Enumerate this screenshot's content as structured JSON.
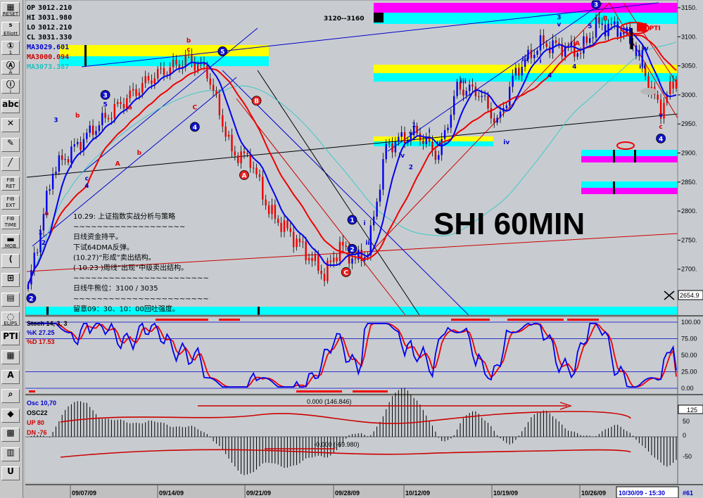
{
  "toolbar": [
    {
      "name": "reset-button",
      "glyph": "▦",
      "label": "RESET"
    },
    {
      "name": "elliott-button",
      "glyph": "⁵",
      "label": "Elliott"
    },
    {
      "name": "elliott-count-1-button",
      "glyph": "①",
      "label": "1"
    },
    {
      "name": "elliott-count-a-button",
      "glyph": "Ⓐ",
      "label": "A"
    },
    {
      "name": "elliott-count-i-button",
      "glyph": "ⓘ",
      "label": "i"
    },
    {
      "name": "elliott-count-abc-button",
      "glyph": "abc",
      "label": ""
    },
    {
      "name": "cross-tool-button",
      "glyph": "✕",
      "label": ""
    },
    {
      "name": "pencil-tool-button",
      "glyph": "✎",
      "label": ""
    },
    {
      "name": "line-tool-button",
      "glyph": "╱",
      "label": ""
    },
    {
      "name": "fib-ret-button",
      "glyph": "",
      "label": "FIB RET"
    },
    {
      "name": "fib-ext-button",
      "glyph": "",
      "label": "FIB EXT"
    },
    {
      "name": "fib-time-button",
      "glyph": "",
      "label": "FIB TIME"
    },
    {
      "name": "mob-button",
      "glyph": "▬",
      "label": "MOB"
    },
    {
      "name": "fan-button",
      "glyph": "⟨",
      "label": ""
    },
    {
      "name": "channel-button",
      "glyph": "⊞",
      "label": ""
    },
    {
      "name": "grid-button",
      "glyph": "▤",
      "label": ""
    },
    {
      "name": "ellipse-button",
      "glyph": "◌",
      "label": "ELIPS"
    },
    {
      "name": "pti-button",
      "glyph": "PTI",
      "label": ""
    },
    {
      "name": "box-button",
      "glyph": "▦",
      "label": ""
    },
    {
      "name": "text-tool-button",
      "glyph": "A",
      "label": ""
    },
    {
      "name": "zoom-button",
      "glyph": "⌕",
      "label": ""
    },
    {
      "name": "eraser-button",
      "glyph": "◆",
      "label": ""
    },
    {
      "name": "checker-button",
      "glyph": "▩",
      "label": ""
    },
    {
      "name": "notes-button",
      "glyph": "▥",
      "label": ""
    },
    {
      "name": "magnet-button",
      "glyph": "U",
      "label": ""
    }
  ],
  "ohlc": [
    {
      "key": "OP",
      "value": "3012.210"
    },
    {
      "key": "HI",
      "value": "3031.980"
    },
    {
      "key": "LO",
      "value": "3012.210"
    },
    {
      "key": "CL",
      "value": "3031.330"
    }
  ],
  "ma": [
    {
      "label": "MA3029.601",
      "color": "#0000cc"
    },
    {
      "label": "MA3000.094",
      "color": "#cc0000"
    },
    {
      "label": "MA3073.387",
      "color": "#20c0c0"
    }
  ],
  "chart_data": {
    "type": "candlestick",
    "title": "SHI 60MIN",
    "y_axis_ticks": [
      3150,
      3100,
      3050,
      3000,
      2950,
      2900,
      2850,
      2800,
      2750,
      2700
    ],
    "ylim": [
      2635,
      3160
    ],
    "current_price_box": "2654.9",
    "date_labels": [
      "09/07/09",
      "09/14/09",
      "09/21/09",
      "09/28/09",
      "10/12/09",
      "10/19/09",
      "10/26/09"
    ],
    "last_bar_label": "10/30/09 - 15:30",
    "bar_count_label": "#61",
    "price_anchors": [
      [
        0,
        2668
      ],
      [
        8,
        2870
      ],
      [
        18,
        2925
      ],
      [
        30,
        2985
      ],
      [
        40,
        3030
      ],
      [
        52,
        3062
      ],
      [
        58,
        3040
      ],
      [
        62,
        2970
      ],
      [
        66,
        2900
      ],
      [
        72,
        2890
      ],
      [
        78,
        2800
      ],
      [
        86,
        2755
      ],
      [
        96,
        2690
      ],
      [
        101,
        2740
      ],
      [
        106,
        2715
      ],
      [
        110,
        2730
      ],
      [
        116,
        2910
      ],
      [
        121,
        2925
      ],
      [
        126,
        2935
      ],
      [
        133,
        2895
      ],
      [
        139,
        3012
      ],
      [
        146,
        3005
      ],
      [
        152,
        2950
      ],
      [
        158,
        3040
      ],
      [
        166,
        3088
      ],
      [
        173,
        3082
      ],
      [
        179,
        3075
      ],
      [
        184,
        3120
      ],
      [
        191,
        3115
      ],
      [
        196,
        3090
      ],
      [
        202,
        3005
      ],
      [
        205,
        2975
      ],
      [
        210,
        3032
      ]
    ],
    "range_label": "3120--3160",
    "pti_label": "80 PTI",
    "commentary": [
      "10.29: 上证指数实战分析与策略",
      "~~~~~~~~~~~~~~~~~~~",
      "日线资金持平。",
      "下试64DMA反弹。",
      "(10.27)“形成”卖出结构。",
      "( 10.23 )周线“出现”中级卖出结构。",
      "~~~~~~~~~~~~~~~~~~~~~~~",
      "日线牛熊位：3100 / 3035",
      "~~~~~~~~~~~~~~~~~~~~~~~",
      "留意09：30、10：00回吐强度。"
    ],
    "wave_labels": [
      {
        "bar": 1,
        "price": 2650,
        "text": "2",
        "style": "blue-circle"
      },
      {
        "bar": 4,
        "price": 2760,
        "text": "1",
        "style": "blue"
      },
      {
        "bar": 5,
        "price": 2742,
        "text": "2",
        "style": "blue"
      },
      {
        "bar": 6,
        "price": 2793,
        "text": "a",
        "style": "red"
      },
      {
        "bar": 9,
        "price": 2953,
        "text": "3",
        "style": "blue"
      },
      {
        "bar": 16,
        "price": 2961,
        "text": "b",
        "style": "red"
      },
      {
        "bar": 19,
        "price": 2853,
        "text": "c",
        "style": "blue"
      },
      {
        "bar": 19,
        "price": 2840,
        "text": "4",
        "style": "blue"
      },
      {
        "bar": 25,
        "price": 3000,
        "text": "3",
        "style": "blue-circle"
      },
      {
        "bar": 25,
        "price": 2980,
        "text": "5",
        "style": "blue"
      },
      {
        "bar": 29,
        "price": 2878,
        "text": "A",
        "style": "red"
      },
      {
        "bar": 33,
        "price": 2975,
        "text": "a",
        "style": "red"
      },
      {
        "bar": 36,
        "price": 2897,
        "text": "b",
        "style": "red"
      },
      {
        "bar": 52,
        "price": 3090,
        "text": "b",
        "style": "red"
      },
      {
        "bar": 52,
        "price": 3075,
        "text": "c",
        "style": "red"
      },
      {
        "bar": 54,
        "price": 2975,
        "text": "C",
        "style": "red"
      },
      {
        "bar": 54,
        "price": 2945,
        "text": "4",
        "style": "blue-circle"
      },
      {
        "bar": 63,
        "price": 3075,
        "text": "5",
        "style": "blue-circle"
      },
      {
        "bar": 74,
        "price": 2990,
        "text": "B",
        "style": "red-circle"
      },
      {
        "bar": 70,
        "price": 2862,
        "text": "A",
        "style": "red-circle"
      },
      {
        "bar": 105,
        "price": 2785,
        "text": "1",
        "style": "blue-circle"
      },
      {
        "bar": 105,
        "price": 2735,
        "text": "2",
        "style": "blue-circle"
      },
      {
        "bar": 109,
        "price": 2776,
        "text": "i",
        "style": "blue"
      },
      {
        "bar": 110,
        "price": 2742,
        "text": "ii",
        "style": "blue"
      },
      {
        "bar": 103,
        "price": 2695,
        "text": "C",
        "style": "red-circle"
      },
      {
        "bar": 121,
        "price": 2892,
        "text": "iv",
        "style": "blue"
      },
      {
        "bar": 124,
        "price": 2872,
        "text": "2",
        "style": "blue"
      },
      {
        "bar": 125,
        "price": 2945,
        "text": "1",
        "style": "blue"
      },
      {
        "bar": 124,
        "price": 2930,
        "text": "v",
        "style": "blue"
      },
      {
        "bar": 130,
        "price": 2935,
        "text": "i",
        "style": "blue"
      },
      {
        "bar": 133,
        "price": 2913,
        "text": "ii",
        "style": "blue"
      },
      {
        "bar": 141,
        "price": 3020,
        "text": "iii",
        "style": "blue"
      },
      {
        "bar": 155,
        "price": 2915,
        "text": "iv",
        "style": "blue"
      },
      {
        "bar": 172,
        "price": 3130,
        "text": "3",
        "style": "blue"
      },
      {
        "bar": 172,
        "price": 3118,
        "text": "v",
        "style": "blue"
      },
      {
        "bar": 169,
        "price": 3030,
        "text": "4",
        "style": "blue"
      },
      {
        "bar": 182,
        "price": 3115,
        "text": "5",
        "style": "blue"
      },
      {
        "bar": 187,
        "price": 3128,
        "text": "B",
        "style": "red"
      },
      {
        "bar": 161,
        "price": 3058,
        "text": "iii",
        "style": "blue"
      },
      {
        "bar": 166,
        "price": 3055,
        "text": "i",
        "style": "blue"
      },
      {
        "bar": 178,
        "price": 3085,
        "text": "A",
        "style": "red"
      },
      {
        "bar": 180,
        "price": 3080,
        "text": "i",
        "style": "red"
      },
      {
        "bar": 177,
        "price": 3045,
        "text": "4",
        "style": "blue"
      },
      {
        "bar": 184,
        "price": 3156,
        "text": "3",
        "style": "blue-circle"
      },
      {
        "bar": 200,
        "price": 3077,
        "text": "iv",
        "style": "blue"
      },
      {
        "bar": 199,
        "price": 3045,
        "text": "iii",
        "style": "blue"
      },
      {
        "bar": 205,
        "price": 2962,
        "text": "v",
        "style": "blue"
      },
      {
        "bar": 205,
        "price": 2942,
        "text": "c",
        "style": "red"
      },
      {
        "bar": 205,
        "price": 2925,
        "text": "4",
        "style": "blue-circle"
      }
    ],
    "stochastic": {
      "label": "Stoch 14, 3, 3",
      "k_label": "%K",
      "k_value": "27.25",
      "d_label": "%D",
      "d_value": "17.53",
      "axis_ticks": [
        "100.00",
        "75.00",
        "50.00",
        "25.00",
        "0.00"
      ]
    },
    "oscillator": {
      "label": "Osc 10,70",
      "sub_label": "OSC22",
      "up_label": "UP",
      "up_value": "80",
      "dn_label": "DN",
      "dn_value": "-76",
      "top_annotation": "0.000 (146.846)",
      "mid_annotation": "-0.000 (-69.980)",
      "axis_ticks": [
        "125",
        "50",
        "0",
        "-50"
      ]
    }
  }
}
